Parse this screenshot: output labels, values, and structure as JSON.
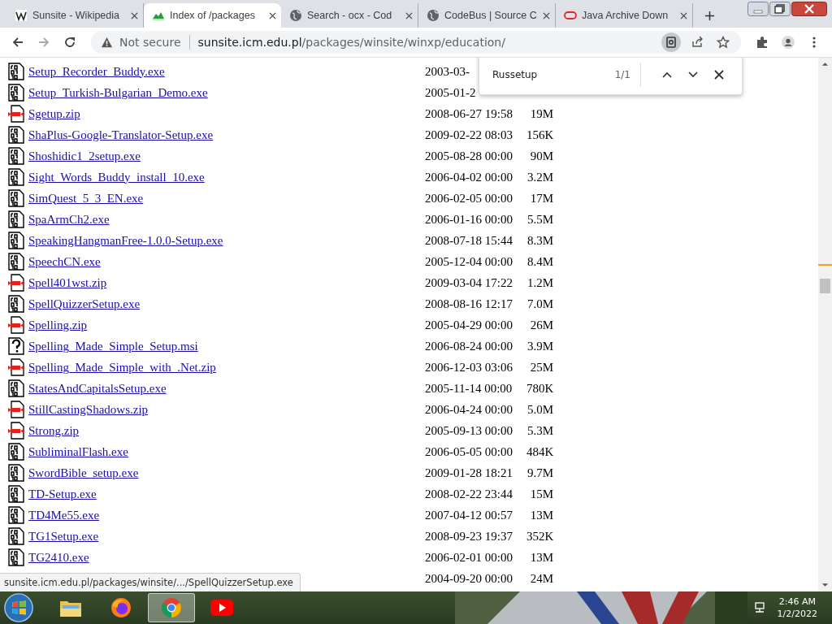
{
  "tabs": [
    {
      "title": "Sunsite - Wikipedia",
      "selected": false
    },
    {
      "title": "Index of /packages",
      "selected": true
    },
    {
      "title": "Search - ocx - Cod",
      "selected": false
    },
    {
      "title": "CodeBus | Source C",
      "selected": false
    },
    {
      "title": "Java Archive Down",
      "selected": false
    }
  ],
  "address": {
    "security": "Not secure",
    "host": "sunsite.icm.edu.pl",
    "path": "/packages/winsite/winxp/education/"
  },
  "find_bar": {
    "query": "Russetup",
    "count": "1/1"
  },
  "rows": [
    {
      "kind": "binary",
      "name": "Setup_Recorder_Buddy.exe",
      "date": "2003-03-"
    },
    {
      "kind": "binary",
      "name": "Setup_Turkish-Bulgarian_Demo.exe",
      "date": "2005-01-2"
    },
    {
      "kind": "compressed",
      "name": "Sgetup.zip",
      "date": "2008-06-27 19:58",
      "size": "19M"
    },
    {
      "kind": "binary",
      "name": "ShaPlus-Google-Translator-Setup.exe",
      "date": "2009-02-22 08:03",
      "size": "156K"
    },
    {
      "kind": "binary",
      "name": "Shoshidic1_2setup.exe",
      "date": "2005-08-28 00:00",
      "size": "90M"
    },
    {
      "kind": "binary",
      "name": "Sight_Words_Buddy_install_10.exe",
      "date": "2006-04-02 00:00",
      "size": "3.2M"
    },
    {
      "kind": "binary",
      "name": "SimQuest_5_3_EN.exe",
      "date": "2006-02-05 00:00",
      "size": "17M"
    },
    {
      "kind": "binary",
      "name": "SpaArmCh2.exe",
      "date": "2006-01-16 00:00",
      "size": "5.5M"
    },
    {
      "kind": "binary",
      "name": "SpeakingHangmanFree-1.0.0-Setup.exe",
      "date": "2008-07-18 15:44",
      "size": "8.3M"
    },
    {
      "kind": "binary",
      "name": "SpeechCN.exe",
      "date": "2005-12-04 00:00",
      "size": "8.4M"
    },
    {
      "kind": "compressed",
      "name": "Spell401wst.zip",
      "date": "2009-03-04 17:22",
      "size": "1.2M"
    },
    {
      "kind": "binary",
      "name": "SpellQuizzerSetup.exe",
      "date": "2008-08-16 12:17",
      "size": "7.0M"
    },
    {
      "kind": "compressed",
      "name": "Spelling.zip",
      "date": "2005-04-29 00:00",
      "size": "26M"
    },
    {
      "kind": "unknown",
      "name": "Spelling_Made_Simple_Setup.msi",
      "date": "2006-08-24 00:00",
      "size": "3.9M"
    },
    {
      "kind": "compressed",
      "name": "Spelling_Made_Simple_with_.Net.zip",
      "date": "2006-12-03 03:06",
      "size": "25M"
    },
    {
      "kind": "binary",
      "name": "StatesAndCapitalsSetup.exe",
      "date": "2005-11-14 00:00",
      "size": "780K"
    },
    {
      "kind": "compressed",
      "name": "StillCastingShadows.zip",
      "date": "2006-04-24 00:00",
      "size": "5.0M"
    },
    {
      "kind": "compressed",
      "name": "Strong.zip",
      "date": "2005-09-13 00:00",
      "size": "5.3M"
    },
    {
      "kind": "binary",
      "name": "SubliminalFlash.exe",
      "date": "2006-05-05 00:00",
      "size": "484K"
    },
    {
      "kind": "binary",
      "name": "SwordBible_setup.exe",
      "date": "2009-01-28 18:21",
      "size": "9.7M"
    },
    {
      "kind": "binary",
      "name": "TD-Setup.exe",
      "date": "2008-02-22 23:44",
      "size": "15M"
    },
    {
      "kind": "binary",
      "name": "TD4Me55.exe",
      "date": "2007-04-12 00:57",
      "size": "13M"
    },
    {
      "kind": "binary",
      "name": "TG1Setup.exe",
      "date": "2008-09-23 19:37",
      "size": "352K"
    },
    {
      "kind": "binary",
      "name": "TG2410.exe",
      "date": "2006-02-01 00:00",
      "size": "13M"
    },
    {
      "date": "2004-09-20 00:00",
      "size": "24M"
    }
  ],
  "status_url": "sunsite.icm.edu.pl/packages/winsite/.../SpellQuizzerSetup.exe",
  "taskbar": {
    "apps": [
      {
        "kind": "start"
      },
      {
        "kind": "folder",
        "selected": false
      },
      {
        "kind": "firefox",
        "selected": false
      },
      {
        "kind": "chrome",
        "selected": true
      },
      {
        "kind": "youtube",
        "selected": false
      }
    ],
    "time": "2:46 AM",
    "date": "1/2/2022"
  }
}
